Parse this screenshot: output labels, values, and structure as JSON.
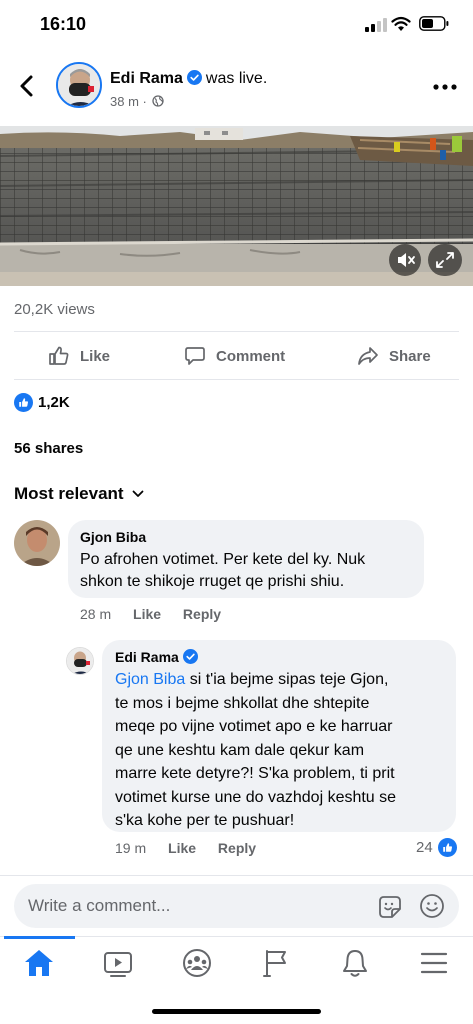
{
  "status_bar": {
    "time": "16:10"
  },
  "post": {
    "author": "Edi Rama",
    "action": "was live.",
    "time": "38 m",
    "views": "20,2K views",
    "actions": {
      "like": "Like",
      "comment": "Comment",
      "share": "Share"
    },
    "reactions_count": "1,2K",
    "shares": "56 shares"
  },
  "comments_header": {
    "sort_label": "Most relevant"
  },
  "comments": [
    {
      "author": "Gjon Biba",
      "lines": [
        "Po afrohen votimet. Per kete del ky. Nuk",
        "shkon te shikoje rruget qe prishi shiu."
      ],
      "time": "28 m",
      "like": "Like",
      "reply": "Reply"
    }
  ],
  "reply": {
    "author": "Edi Rama",
    "mention": "Gjon Biba",
    "first_line_rest": " si t'ia bejme sipas teje Gjon,",
    "lines": [
      "te mos i bejme shkollat dhe shtepite",
      "meqe po vijne votimet apo e ke harruar",
      "qe une keshtu kam dale qekur kam",
      "marre kete detyre?! S'ka problem, ti prit",
      "votimet kurse une do vazhdoj keshtu se",
      "s'ka kohe per te pushuar!"
    ],
    "time": "19 m",
    "like": "Like",
    "reply": "Reply",
    "reaction_count": "24"
  },
  "composer": {
    "placeholder": "Write a comment..."
  },
  "tabs": [
    "home-icon",
    "video-icon",
    "groups-icon",
    "pages-flag-icon",
    "notifications-bell-icon",
    "menu-icon"
  ],
  "colors": {
    "accent": "#1877f2",
    "secondary_text": "#65676b",
    "bubble": "#f0f2f5"
  }
}
